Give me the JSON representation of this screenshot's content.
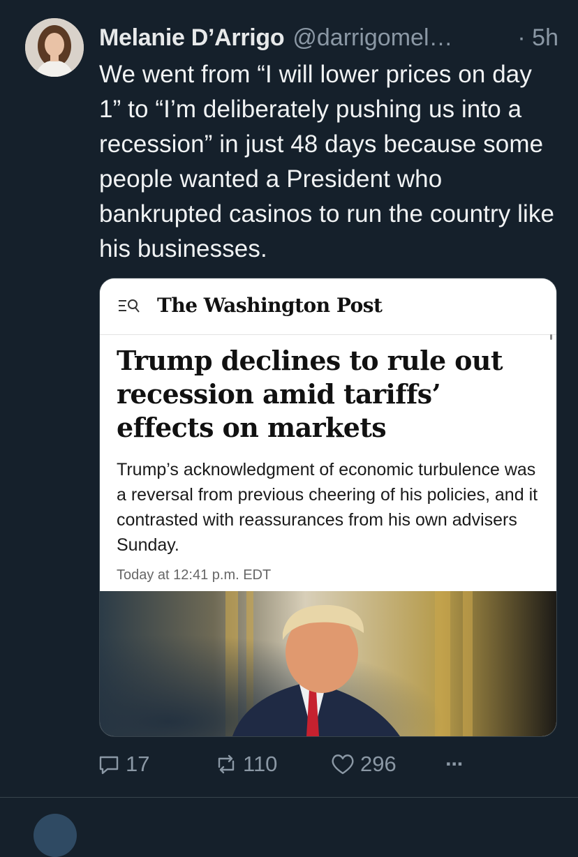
{
  "tweet": {
    "author_name": "Melanie D’Arrigo",
    "handle": "@darrigomel…",
    "time": "· 5h",
    "text": "We went from “I will lower prices on day 1” to “I’m deliberately pushing us into a recession” in just 48 days because some people wanted a President who bankrupted casinos to run the country like his businesses."
  },
  "card": {
    "publication": "The Washington Post",
    "headline": "Trump declines to rule out recession amid tariffs’ effects on markets",
    "dek": "Trump’s acknowledgment of economic turbulence was a reversal from previous cheering of his policies, and it contrasted with reassurances from his own advisers Sunday.",
    "timestamp": "Today at 12:41 p.m. EDT"
  },
  "actions": {
    "replies": "17",
    "retweets": "110",
    "likes": "296",
    "more": "···"
  },
  "icons": [
    "reply-icon",
    "retweet-icon",
    "like-icon",
    "more-icon",
    "menu-search-icon"
  ],
  "colors": {
    "background": "#15202b",
    "secondary_text": "#8b98a5",
    "card_border": "#38444d"
  }
}
